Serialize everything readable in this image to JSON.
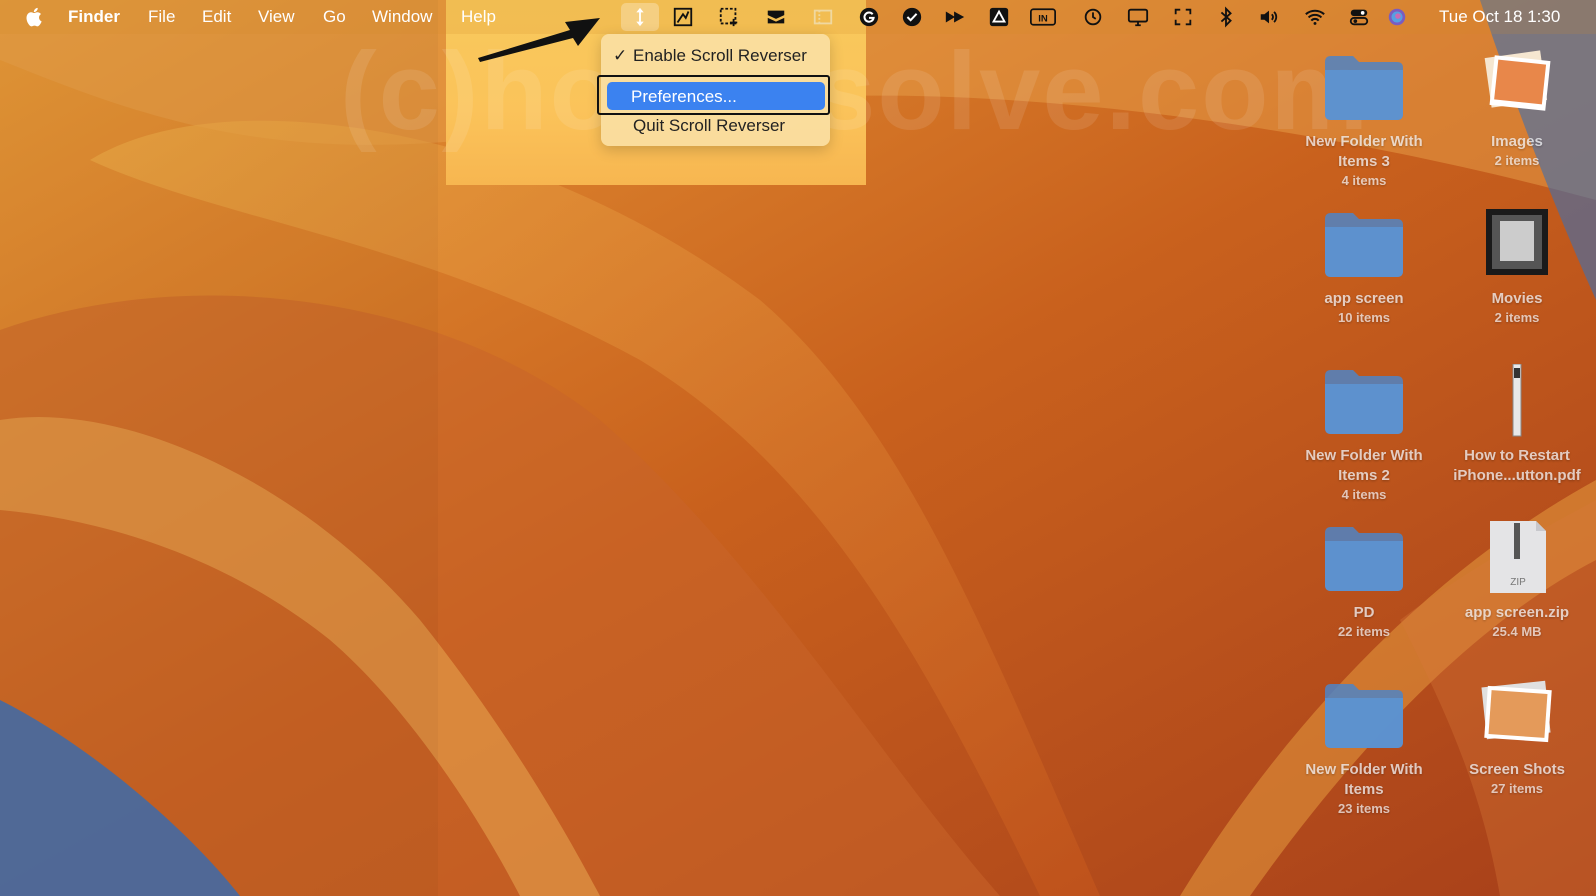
{
  "menubar": {
    "app_name": "Finder",
    "menus": [
      "File",
      "Edit",
      "View",
      "Go",
      "Window",
      "Help"
    ],
    "status_icons": [
      "scroll-reverser-icon",
      "crop-tool-icon",
      "screenshot-region-icon",
      "layered-app-icon",
      "window-layout-icon",
      "grammarly-icon",
      "checkmark-badge-icon",
      "fast-forward-app-icon",
      "drive-icon",
      "input-source-icon",
      "time-machine-icon",
      "display-icon",
      "fullscreen-icon",
      "bluetooth-icon",
      "volume-icon",
      "wifi-icon",
      "control-center-icon",
      "siri-icon"
    ],
    "input_source_label": "IN",
    "clock": "Tue Oct 18  1:30"
  },
  "dropdown": {
    "items": [
      {
        "label": "Enable Scroll Reverser",
        "checked": true
      },
      {
        "label": "Preferences...",
        "highlighted": true
      },
      {
        "label": "Quit Scroll Reverser"
      }
    ],
    "highlight_color": "#3b82f0"
  },
  "watermark": "(c)howtosolve.com",
  "desktop_icons": [
    {
      "name": "New Folder With Items 3",
      "meta": "4 items",
      "kind": "folder"
    },
    {
      "name": "Images",
      "meta": "2 items",
      "kind": "photos"
    },
    {
      "name": "app screen",
      "meta": "10 items",
      "kind": "folder"
    },
    {
      "name": "Movies",
      "meta": "2 items",
      "kind": "movie"
    },
    {
      "name": "New Folder With Items 2",
      "meta": "4 items",
      "kind": "folder"
    },
    {
      "name": "How to Restart iPhone...utton.pdf",
      "meta": "",
      "kind": "pdf"
    },
    {
      "name": "PD",
      "meta": "22 items",
      "kind": "folder"
    },
    {
      "name": "app screen.zip",
      "meta": "25.4 MB",
      "kind": "zip"
    },
    {
      "name": "New Folder With Items",
      "meta": "23 items",
      "kind": "folder"
    },
    {
      "name": "Screen Shots",
      "meta": "27 items",
      "kind": "photos"
    }
  ],
  "colors": {
    "folder": "#5a8fc9",
    "menu_text": "#ffffff"
  }
}
